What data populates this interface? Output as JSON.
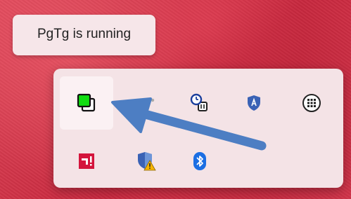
{
  "tooltip": {
    "text": "PgTg is running"
  },
  "tray": {
    "icons": [
      {
        "name": "pgtg-app-icon",
        "hovered": true
      },
      {
        "name": "more-dots-icon"
      },
      {
        "name": "network-clock-icon"
      },
      {
        "name": "vpn-shield-icon"
      },
      {
        "name": "keypad-icon"
      },
      {
        "name": "amd-icon"
      },
      {
        "name": "security-warning-icon"
      },
      {
        "name": "bluetooth-icon"
      }
    ]
  },
  "colors": {
    "pgtg_green": "#11dd11",
    "arrow_blue": "#4d7ec3",
    "amd_red": "#d4143c",
    "bluetooth_blue": "#1b6ee3",
    "shield_blue": "#3a62b5",
    "warning_yellow": "#f6b400"
  }
}
